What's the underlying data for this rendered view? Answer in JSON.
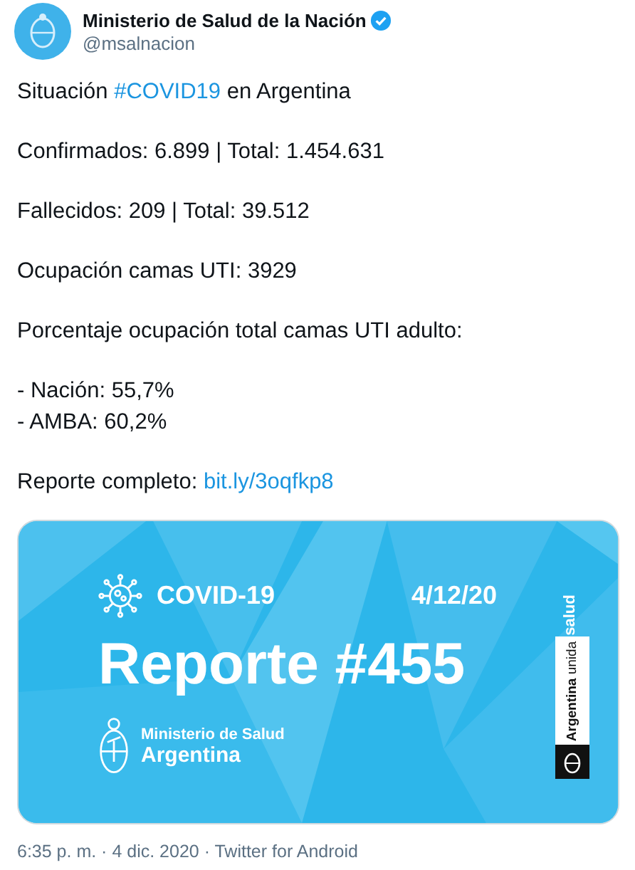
{
  "author": {
    "name": "Ministerio de Salud de la Nación",
    "verified": true,
    "handle": "@msalnacion"
  },
  "paragraphs": [
    {
      "lines": [
        [
          {
            "text": "Situación ",
            "kind": "plain"
          },
          {
            "text": "#COVID19",
            "kind": "hashtag"
          },
          {
            "text": " en Argentina",
            "kind": "plain"
          }
        ]
      ]
    },
    {
      "lines": [
        [
          {
            "text": "Confirmados: 6.899 | Total: 1.454.631",
            "kind": "plain"
          }
        ]
      ]
    },
    {
      "lines": [
        [
          {
            "text": "Fallecidos: 209 | Total: 39.512",
            "kind": "plain"
          }
        ]
      ]
    },
    {
      "lines": [
        [
          {
            "text": "Ocupación camas UTI: 3929",
            "kind": "plain"
          }
        ]
      ]
    },
    {
      "lines": [
        [
          {
            "text": "Porcentaje ocupación total camas UTI adulto:",
            "kind": "plain"
          }
        ]
      ]
    },
    {
      "lines": [
        [
          {
            "text": "- Nación: 55,7%",
            "kind": "plain"
          }
        ],
        [
          {
            "text": "- AMBA: 60,2%",
            "kind": "plain"
          }
        ]
      ]
    },
    {
      "lines": [
        [
          {
            "text": "Reporte completo: ",
            "kind": "plain"
          },
          {
            "text": "bit.ly/3oqfkp8",
            "kind": "url"
          }
        ]
      ]
    }
  ],
  "card": {
    "topic": "COVID-19",
    "date": "4/12/20",
    "title": "Reporte #455",
    "org_line1": "Ministerio de Salud",
    "org_line2": "Argentina",
    "side_label": "salud",
    "side_brand": "**Argentina** unida"
  },
  "footer": {
    "meta": "6:35 p. m. · 4 dic. 2020 · Twitter for Android"
  }
}
